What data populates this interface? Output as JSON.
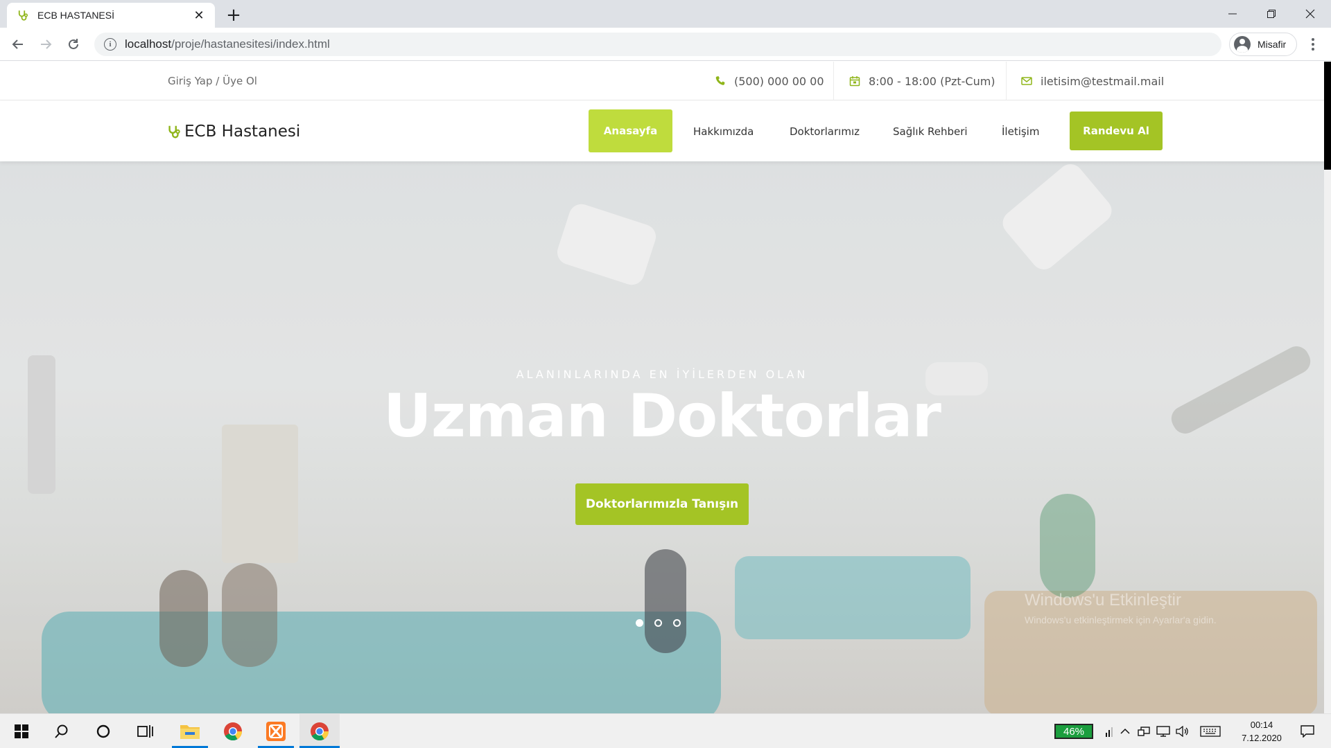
{
  "browser": {
    "tab_title": "ECB HASTANESİ",
    "url_host": "localhost",
    "url_path": "/proje/hastanesitesi/index.html",
    "profile_name": "Misafir"
  },
  "topbar": {
    "login_text": "Giriş Yap / Üye Ol",
    "phone": "(500) 000 00 00",
    "hours": "8:00 - 18:00 (Pzt-Cum)",
    "email": "iletisim@testmail.mail"
  },
  "nav": {
    "brand": "ECB Hastanesi",
    "items": [
      {
        "label": "Anasayfa",
        "active": true
      },
      {
        "label": "Hakkımızda"
      },
      {
        "label": "Doktorlarımız"
      },
      {
        "label": "Sağlık Rehberi"
      },
      {
        "label": "İletişim"
      }
    ],
    "cta": "Randevu Al"
  },
  "hero": {
    "kicker": "ALANINLARINDA EN İYİLERDEN OLAN",
    "title": "Uzman Doktorlar",
    "button": "Doktorlarımızla Tanışın",
    "slides": 3,
    "active_slide": 1
  },
  "watermark": {
    "line1": "Windows'u Etkinleştir",
    "line2": "Windows'u etkinleştirmek için Ayarlar'a gidin."
  },
  "taskbar": {
    "battery": "46%",
    "time": "00:14",
    "date": "7.12.2020"
  },
  "colors": {
    "accent": "#a4c425",
    "accent_light": "#bfdc3d"
  },
  "icons": {
    "tab_favicon": "stethoscope-icon",
    "phone": "phone-icon",
    "hours": "calendar-icon",
    "email": "envelope-icon",
    "brand": "stethoscope-icon"
  }
}
